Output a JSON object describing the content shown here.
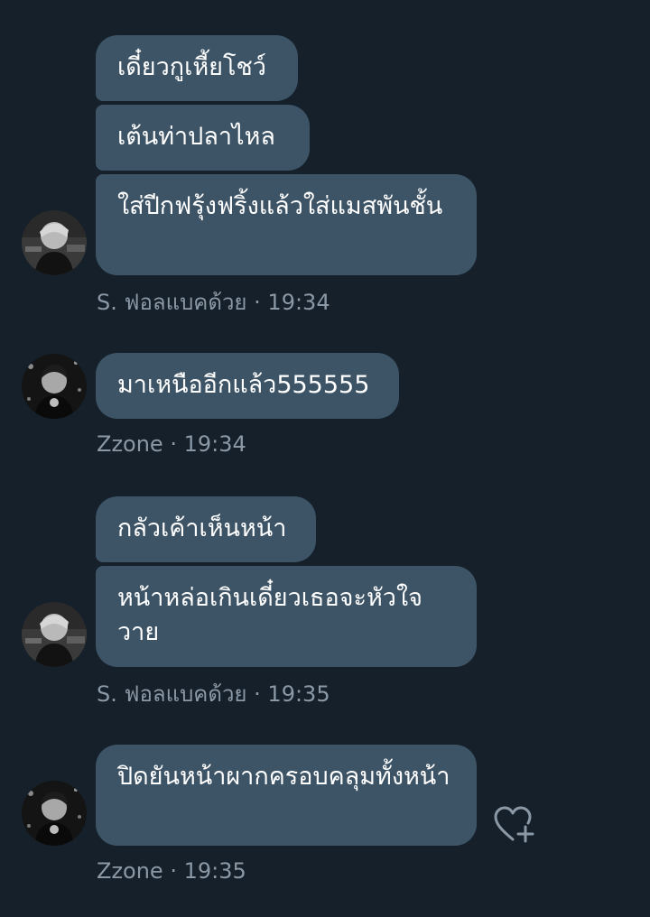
{
  "colors": {
    "background": "#15202b",
    "bubble": "#3d5466",
    "message_text": "#ffffff",
    "meta_text": "#8b98a5"
  },
  "icons": {
    "like": "heart-plus-icon"
  },
  "messages": [
    {
      "sender": "S. ฟอลแบคด้วย",
      "time": "19:34",
      "text": "เดี๋ยวกูเหี้ยโชว์"
    },
    {
      "sender": "S. ฟอลแบคด้วย",
      "time": "19:34",
      "text": "เต้นท่าปลาไหล"
    },
    {
      "sender": "S. ฟอลแบคด้วย",
      "time": "19:34",
      "text": "ใส่ปีกฟรุ้งฟริ้งแล้วใส่แมสพันชั้น"
    },
    {
      "sender": "Zzone",
      "time": "19:34",
      "text": "มาเหนืออีกแล้ว555555"
    },
    {
      "sender": "S. ฟอลแบคด้วย",
      "time": "19:35",
      "text": "กลัวเค้าเห็นหน้า"
    },
    {
      "sender": "S. ฟอลแบคด้วย",
      "time": "19:35",
      "text": "หน้าหล่อเกินเดี๋ยวเธอจะหัวใจวาย"
    },
    {
      "sender": "Zzone",
      "time": "19:35",
      "text": "ปิดยันหน้าผากครอบคลุมทั้งหน้า"
    }
  ],
  "meta_lines": [
    {
      "sender": "S. ฟอลแบคด้วย",
      "separator": "·",
      "time": "19:34"
    },
    {
      "sender": "Zzone",
      "separator": "·",
      "time": "19:34"
    },
    {
      "sender": "S. ฟอลแบคด้วย",
      "separator": "·",
      "time": "19:35"
    },
    {
      "sender": "Zzone",
      "separator": "·",
      "time": "19:35"
    }
  ]
}
